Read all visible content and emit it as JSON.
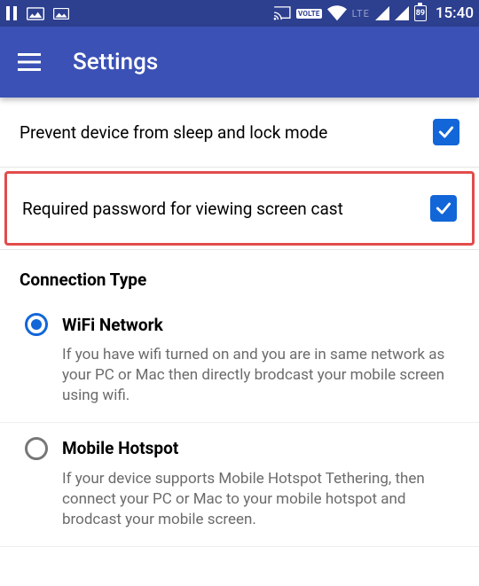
{
  "status": {
    "volte": "VOLTE",
    "lte": "LTE",
    "battery": "89",
    "time": "15:40"
  },
  "appbar": {
    "title": "Settings"
  },
  "options": {
    "prevent_sleep": {
      "label": "Prevent device from sleep and lock mode",
      "checked": true
    },
    "require_password": {
      "label": "Required password for viewing screen cast",
      "checked": true
    }
  },
  "connection": {
    "section_label": "Connection Type",
    "options": [
      {
        "label": "WiFi Network",
        "desc": "If you have wifi turned on and you are in same network as your PC or Mac then directly brodcast your mobile screen using wifi.",
        "selected": true
      },
      {
        "label": "Mobile Hotspot",
        "desc": "If your device supports Mobile Hotspot Tethering, then connect your PC or Mac to your mobile hotspot and brodcast your mobile screen.",
        "selected": false
      }
    ]
  }
}
